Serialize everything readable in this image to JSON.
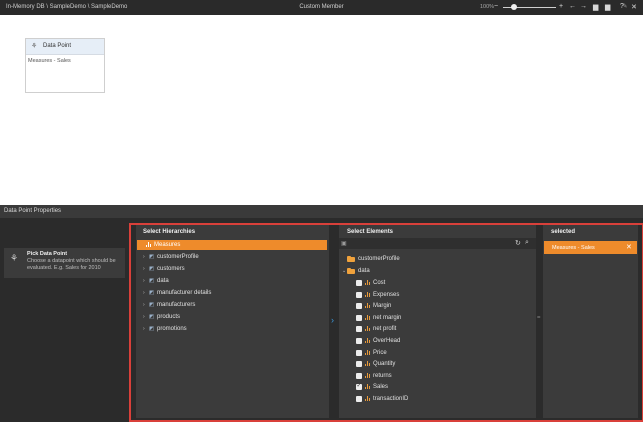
{
  "topbar": {
    "path": "In-Memory DB \\ SampleDemo \\ SampleDemo",
    "title": "Custom Member",
    "zoom": "100%",
    "icons": [
      "zoom-out-icon",
      "zoom-in-icon",
      "undo-icon",
      "redo-icon",
      "save-icon",
      "save-as-icon",
      "help-icon",
      "close-icon"
    ],
    "zoom_level": 0.2
  },
  "canvas": {
    "card_title": "Data Point",
    "card_value": "Measures - Sales"
  },
  "properties": {
    "title": "Data Point Properties"
  },
  "sidebar": {
    "pick_title": "Pick Data Point",
    "pick_desc": "Choose a datapoint which should be evaluated. E.g. Sales for 2010"
  },
  "hierarchies": {
    "header": "Select Hierarchies",
    "selected": "Measures",
    "items": [
      "customerProfile",
      "customers",
      "data",
      "manufacturer details",
      "manufacturers",
      "products",
      "promotions"
    ]
  },
  "elements": {
    "header": "Select Elements",
    "folders": [
      "customerProfile",
      "data"
    ],
    "items": [
      {
        "label": "Cost",
        "checked": false
      },
      {
        "label": "Expenses",
        "checked": false
      },
      {
        "label": "Margin",
        "checked": false
      },
      {
        "label": "net margin",
        "checked": false
      },
      {
        "label": "net profit",
        "checked": false
      },
      {
        "label": "OverHead",
        "checked": false
      },
      {
        "label": "Price",
        "checked": false
      },
      {
        "label": "Quantity",
        "checked": false
      },
      {
        "label": "returns",
        "checked": false
      },
      {
        "label": "Sales",
        "checked": true
      },
      {
        "label": "transactionID",
        "checked": false
      }
    ]
  },
  "selected": {
    "header": "selected",
    "item": "Measures - Sales"
  },
  "colors": {
    "accent": "#ee8b2b",
    "frame": "#d9403a",
    "arrow": "#3b97d8"
  }
}
